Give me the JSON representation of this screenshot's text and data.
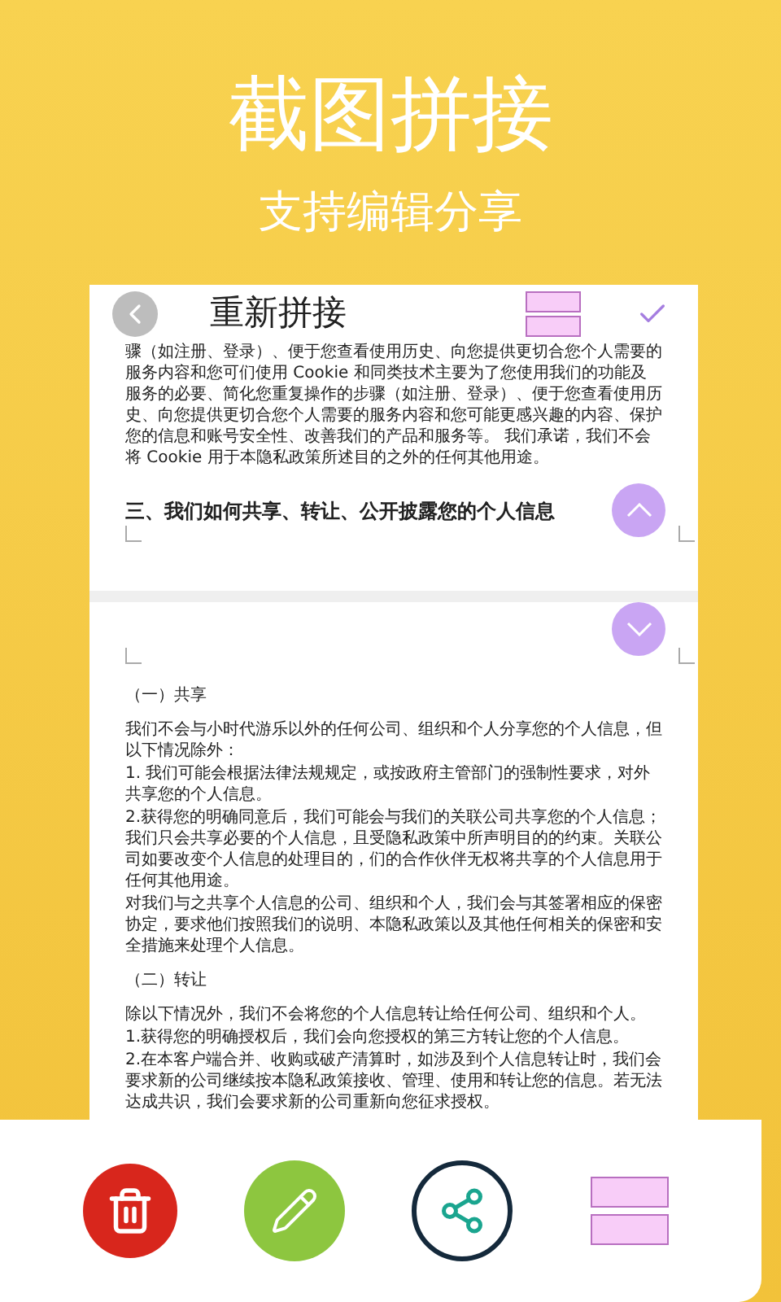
{
  "banner": {
    "title": "截图拼接",
    "subtitle": "支持编辑分享"
  },
  "header": {
    "title": "重新拼接"
  },
  "pages": [
    {
      "blocks": [
        {
          "kind": "paragraph",
          "text": "骤（如注册、登录）、便于您查看使用历史、向您提供更切合您个人需要的服务内容和您可们使用 Cookie 和同类技术主要为了您使用我们的功能及服务的必要、简化您重复操作的步骤（如注册、登录）、便于您查看使用历史、向您提供更切合您个人需要的服务内容和您可能更感兴趣的内容、保护您的信息和账号安全性、改善我们的产品和服务等。 我们承诺，我们不会将 Cookie 用于本隐私政策所述目的之外的任何其他用途。"
        },
        {
          "kind": "heading",
          "text": "三、我们如何共享、转让、公开披露您的个人信息"
        }
      ],
      "kind": "up"
    },
    {
      "blocks": [
        {
          "kind": "subheading",
          "text": "（一）共享"
        },
        {
          "kind": "paragraph",
          "text": "我们不会与小时代游乐以外的任何公司、组织和个人分享您的个人信息，但以下情况除外："
        },
        {
          "kind": "paragraph",
          "text": "1. 我们可能会根据法律法规规定，或按政府主管部门的强制性要求，对外共享您的个人信息。"
        },
        {
          "kind": "paragraph",
          "text": "2.获得您的明确同意后，我们可能会与我们的关联公司共享您的个人信息；我们只会共享必要的个人信息，且受隐私政策中所声明目的的约束。关联公司如要改变个人信息的处理目的，们的合作伙伴无权将共享的个人信息用于任何其他用途。"
        },
        {
          "kind": "paragraph",
          "text": "对我们与之共享个人信息的公司、组织和个人，我们会与其签署相应的保密协定，要求他们按照我们的说明、本隐私政策以及其他任何相关的保密和安全措施来处理个人信息。"
        },
        {
          "kind": "subheading",
          "text": "（二）转让"
        },
        {
          "kind": "paragraph",
          "text": "除以下情况外，我们不会将您的个人信息转让给任何公司、组织和个人。"
        },
        {
          "kind": "paragraph",
          "text": "1.获得您的明确授权后，我们会向您授权的第三方转让您的个人信息。"
        },
        {
          "kind": "paragraph",
          "text": "2.在本客户端合并、收购或破产清算时，如涉及到个人信息转让时，我们会要求新的公司继续按本隐私政策接收、管理、使用和转让您的信息。若无法达成共识，我们会要求新的公司重新向您征求授权。"
        }
      ],
      "kind": "down"
    }
  ],
  "toolbar": [
    {
      "kind": "delete"
    },
    {
      "kind": "edit"
    },
    {
      "kind": "share"
    },
    {
      "kind": "layout"
    }
  ]
}
